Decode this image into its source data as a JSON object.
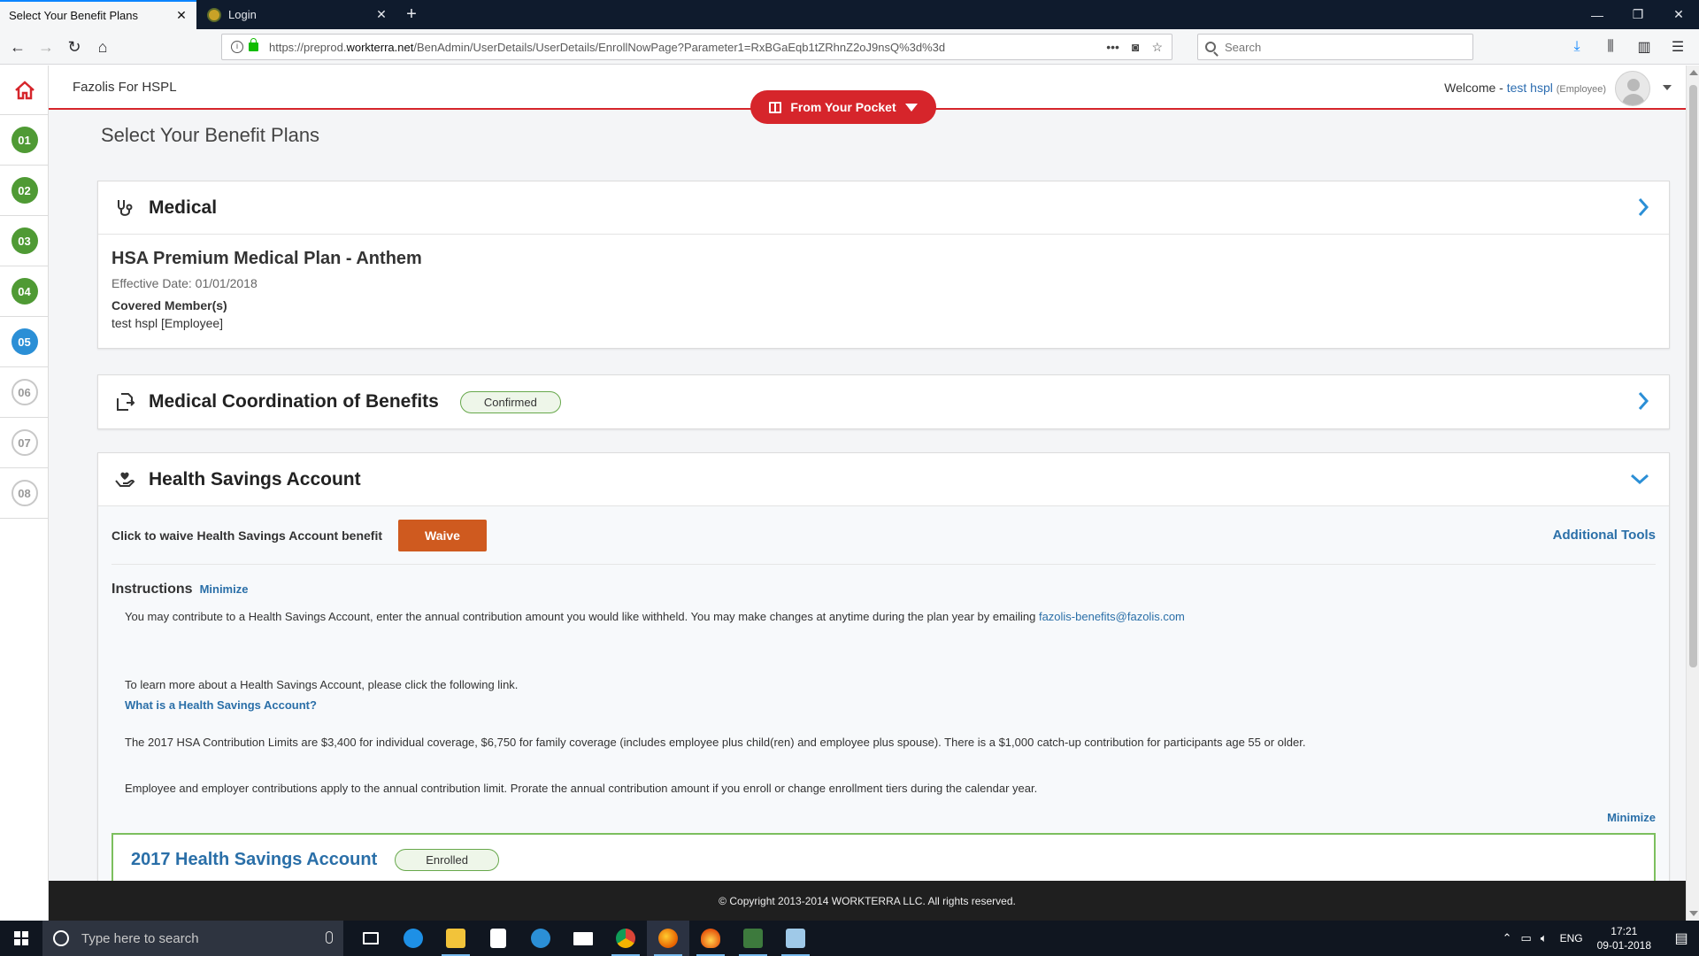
{
  "browser": {
    "tabs": [
      {
        "title": "Select Your Benefit Plans",
        "active": true
      },
      {
        "title": "Login",
        "active": false
      }
    ],
    "url": {
      "prefix": "https://preprod.",
      "domain": "workterra.net",
      "path": "/BenAdmin/UserDetails/UserDetails/EnrollNowPage?Parameter1=RxBGaEqb1tZRhnZ2oJ9nsQ%3d%3d"
    },
    "search_placeholder": "Search"
  },
  "header": {
    "org_name": "Fazolis For HSPL",
    "welcome_label": "Welcome -",
    "user_name": "test hspl",
    "user_role": "(Employee)",
    "pocket_button": "From Your Pocket"
  },
  "steps": [
    {
      "label": "01",
      "state": "done"
    },
    {
      "label": "02",
      "state": "done"
    },
    {
      "label": "03",
      "state": "done"
    },
    {
      "label": "04",
      "state": "done"
    },
    {
      "label": "05",
      "state": "current"
    },
    {
      "label": "06",
      "state": "todo"
    },
    {
      "label": "07",
      "state": "todo"
    },
    {
      "label": "08",
      "state": "todo"
    }
  ],
  "page_title": "Select Your Benefit Plans",
  "medical": {
    "title": "Medical",
    "plan_name": "HSA Premium Medical Plan - Anthem",
    "effective": "Effective Date: 01/01/2018",
    "covered_label": "Covered Member(s)",
    "covered_value": "test hspl [Employee]"
  },
  "cob": {
    "title": "Medical Coordination of Benefits",
    "badge": "Confirmed"
  },
  "hsa": {
    "title": "Health Savings Account",
    "waive_label": "Click to waive Health Savings Account benefit",
    "waive_button": "Waive",
    "additional_tools": "Additional Tools",
    "instructions_title": "Instructions",
    "minimize": "Minimize",
    "p1": "You may contribute to a Health Savings Account, enter the annual contribution amount you would like withheld. You may make changes at anytime during the plan year by emailing",
    "p1_email": "fazolis-benefits@fazolis.com",
    "p2": "To learn more about a Health Savings Account, please click the following link.",
    "link": "What is a Health Savings Account?",
    "p3": "The 2017 HSA Contribution Limits are $3,400 for individual coverage, $6,750 for family coverage (includes employee plus child(ren) and employee plus spouse). There is a $1,000 catch-up contribution for participants age 55 or older.",
    "p4": "Employee and employer contributions apply to the annual contribution limit. Prorate the annual contribution amount if you enroll or change enrollment tiers during the calendar year.",
    "minimize_bottom": "Minimize",
    "plan_title": "2017 Health Savings Account",
    "plan_badge": "Enrolled"
  },
  "footer": {
    "copyright": "© Copyright 2013-2014 WORKTERRA LLC. All rights reserved."
  },
  "taskbar": {
    "search_placeholder": "Type here to search",
    "lang": "ENG",
    "time": "17:21",
    "date": "09-01-2018"
  },
  "colors": {
    "accent_red": "#d6252b",
    "step_done": "#4f9a34",
    "step_current": "#2b8fd6",
    "waive_orange": "#cf5a1f",
    "link_blue": "#2a6fa8"
  }
}
